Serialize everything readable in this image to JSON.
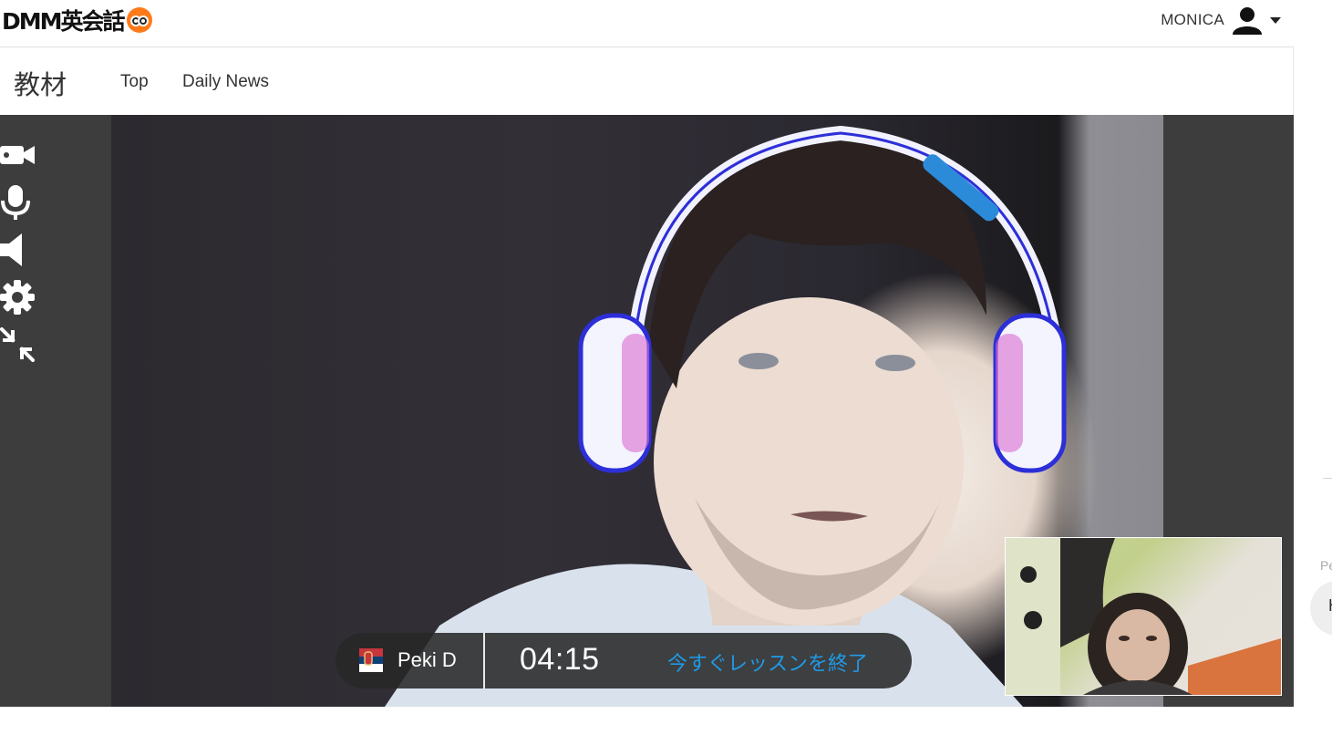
{
  "header": {
    "logo_text": "DMM英会話",
    "logo_icon": "owl-icon",
    "user_name": "MONICA",
    "user_icon": "user-icon",
    "menu_icon": "caret-down-icon"
  },
  "subnav": {
    "title": "教材",
    "links": [
      "Top",
      "Daily News"
    ]
  },
  "toolbar": {
    "icons": [
      "camera-icon",
      "microphone-icon",
      "speaker-icon",
      "settings-gear-icon",
      "shrink-screen-icon"
    ]
  },
  "lesson": {
    "tutor_name": "Peki D",
    "tutor_flag_icon": "serbia-flag-icon",
    "timer": "04:15",
    "end_label": "今すぐレッスンを終了"
  },
  "right_panel": {
    "clipped_text": "Pe",
    "bubble_text": "H"
  },
  "colors": {
    "accent_link": "#1e9be8",
    "logo_owl": "#ff7a1a",
    "video_bg": "#3d3d3d"
  }
}
